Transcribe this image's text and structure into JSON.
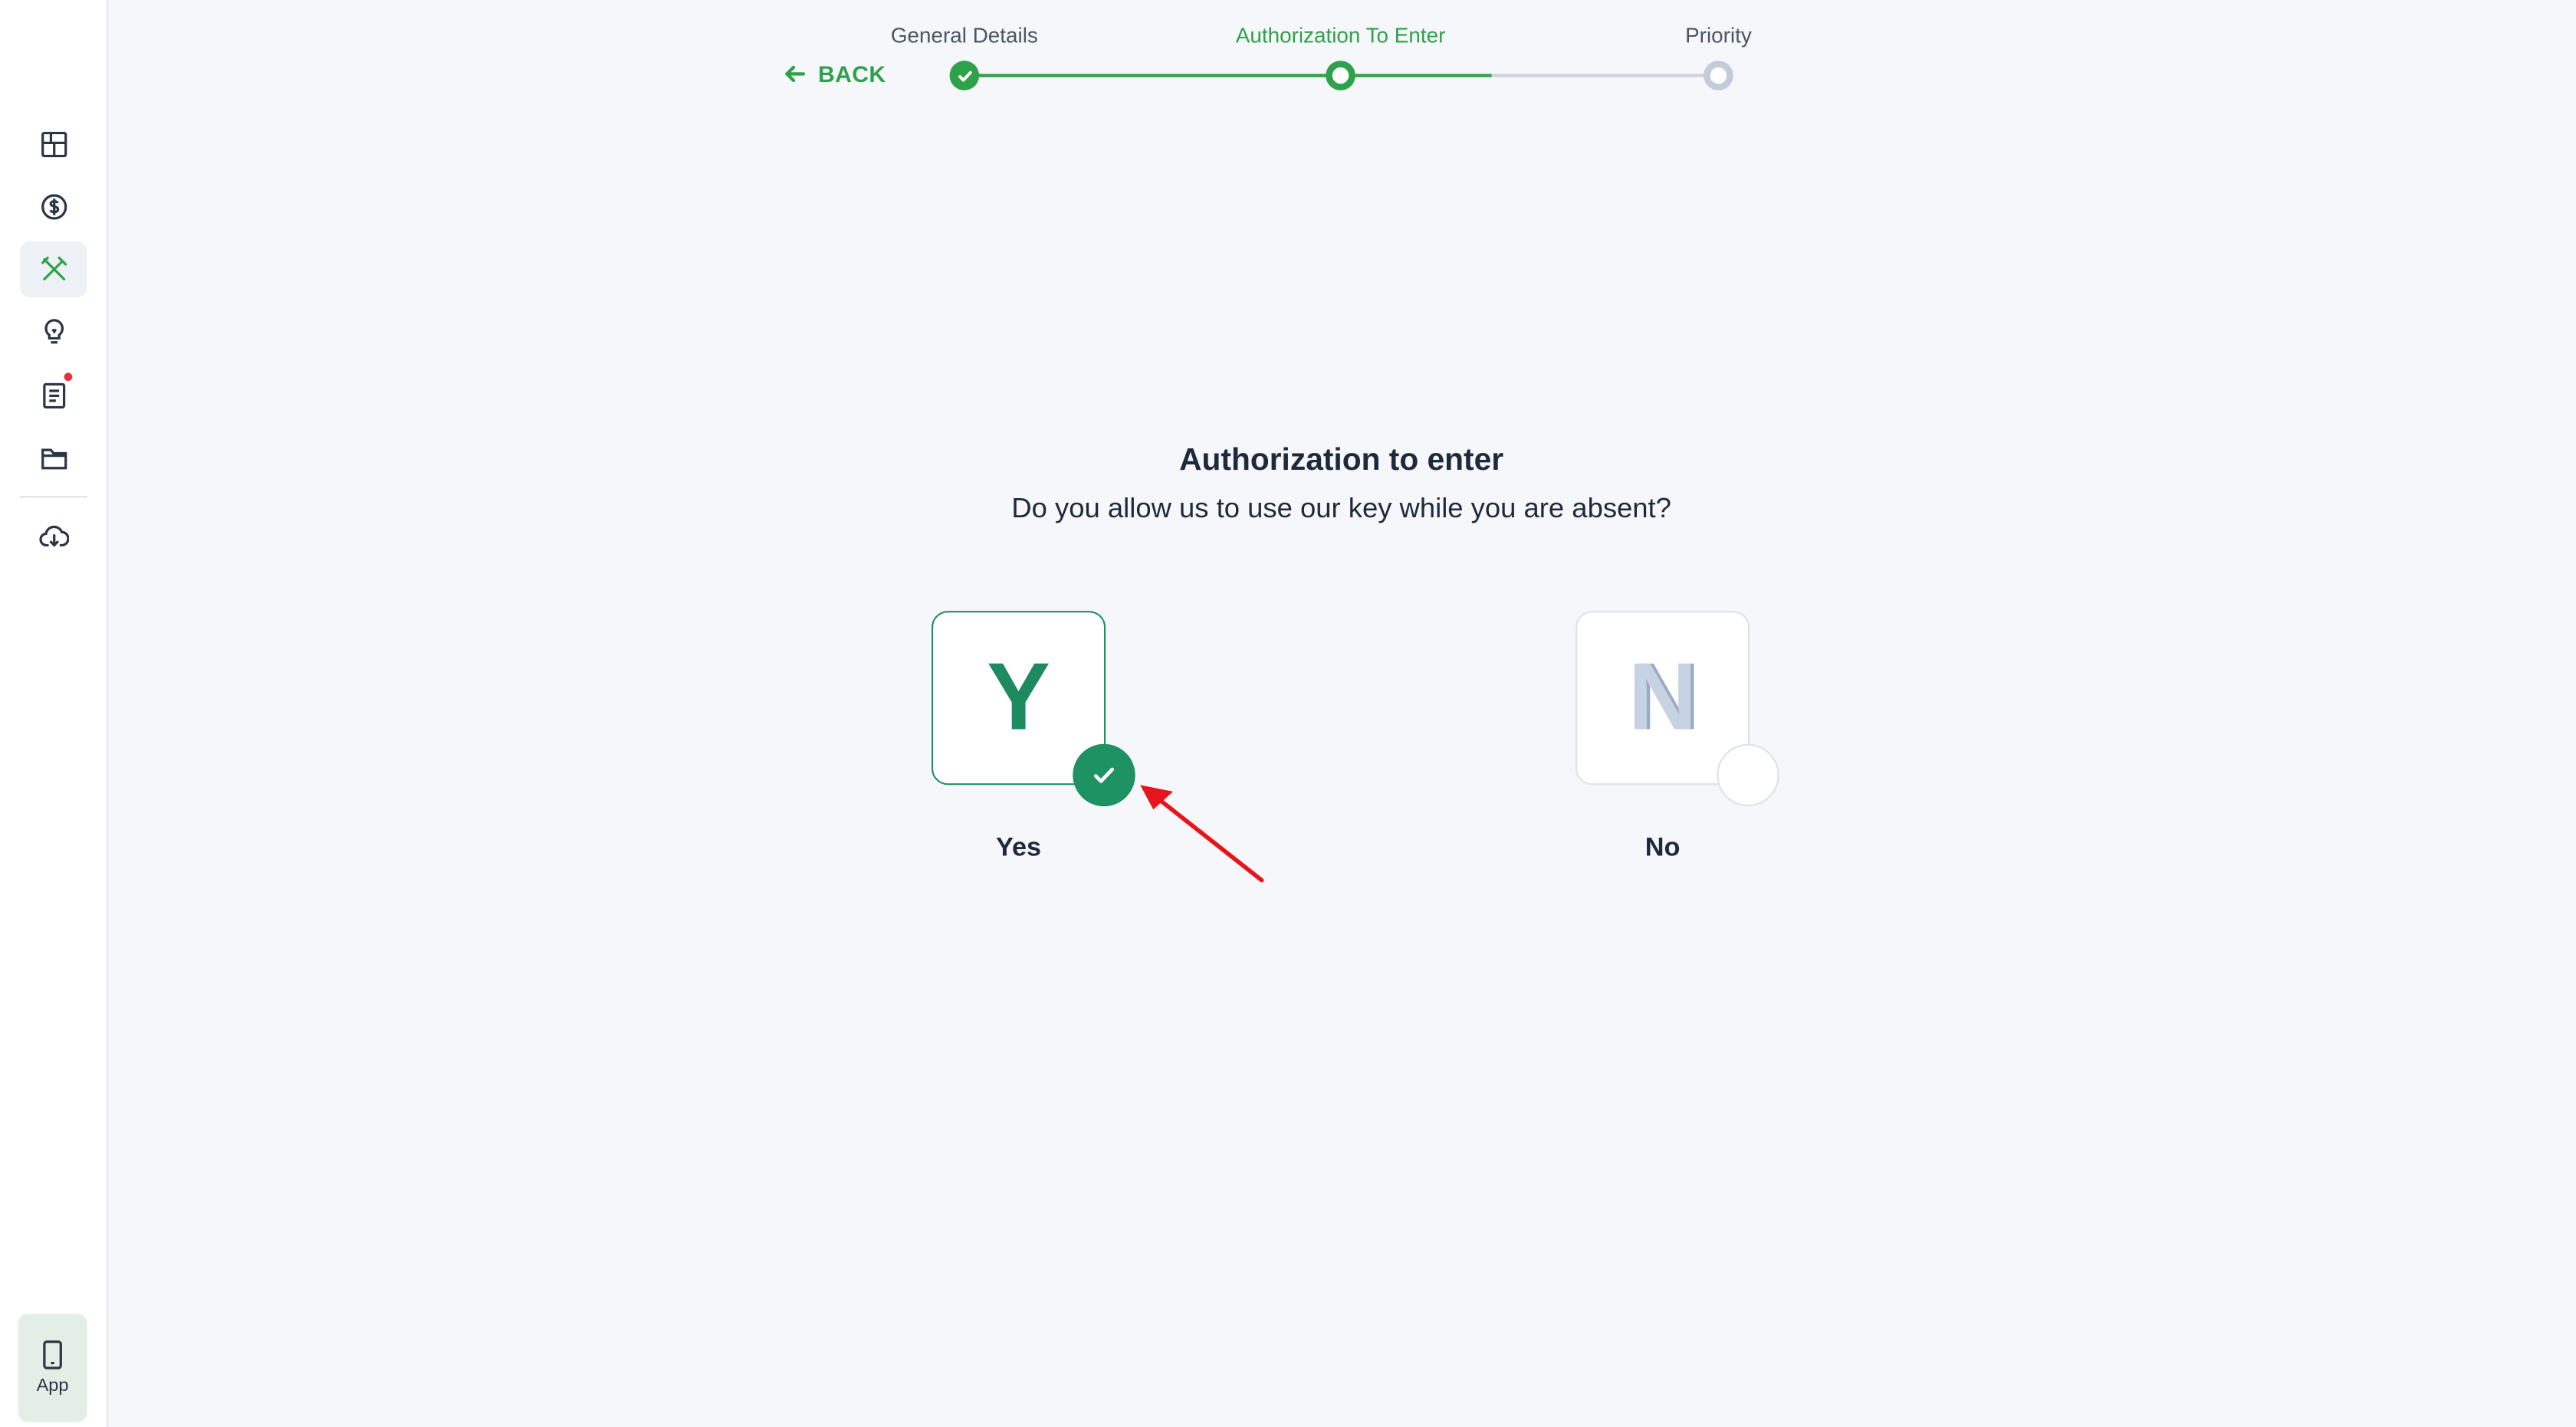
{
  "sidebar": {
    "items": [
      {
        "icon": "dashboard-grid-icon"
      },
      {
        "icon": "dollar-coin-icon"
      },
      {
        "icon": "tools-icon",
        "active": true
      },
      {
        "icon": "lightbulb-icon"
      },
      {
        "icon": "document-list-icon",
        "notification": true
      },
      {
        "icon": "folder-icon"
      },
      {
        "icon": "cloud-download-icon"
      }
    ],
    "app_button": {
      "icon": "mobile-phone-icon",
      "label": "App"
    }
  },
  "header": {
    "back_label": "BACK",
    "steps": [
      {
        "label": "General Details",
        "state": "done"
      },
      {
        "label": "Authorization To Enter",
        "state": "current"
      },
      {
        "label": "Priority",
        "state": "todo"
      }
    ]
  },
  "main": {
    "title": "Authorization to enter",
    "subtitle": "Do you allow us to use our key while you are absent?",
    "options": [
      {
        "letter": "Y",
        "label": "Yes",
        "selected": true
      },
      {
        "letter": "N",
        "label": "No",
        "selected": false
      }
    ]
  },
  "colors": {
    "accent_green": "#2ea24a",
    "selected_green": "#1e9263",
    "background": "#f6f7fb",
    "annotation_arrow": "#e8141c"
  }
}
